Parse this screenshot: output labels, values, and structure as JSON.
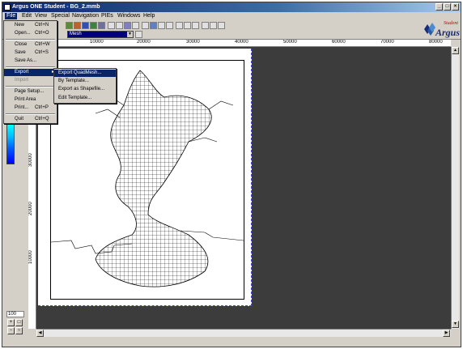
{
  "window": {
    "title": "Argus ONE Student - BG_2.mmb"
  },
  "menubar": {
    "items": [
      "File",
      "Edit",
      "View",
      "Special",
      "Navigation",
      "PIEs",
      "Windows",
      "Help"
    ]
  },
  "toolbar": {
    "layer_combo_value": "Mesh",
    "combo_arrow": "▼"
  },
  "logo": {
    "line1": "Student",
    "line2": "Argus"
  },
  "ruler": {
    "top_labels": [
      "10000",
      "20000",
      "30000",
      "40000",
      "50000",
      "60000",
      "70000",
      "80000"
    ],
    "left_labels": [
      "10000",
      "20000",
      "30000"
    ]
  },
  "file_menu": {
    "items": [
      {
        "label": "New",
        "shortcut": "Ctrl+N"
      },
      {
        "label": "Open...",
        "shortcut": "Ctrl+O"
      },
      {
        "label": "Close",
        "shortcut": "Ctrl+W"
      },
      {
        "label": "Save",
        "shortcut": "Ctrl+S"
      },
      {
        "label": "Save As...",
        "shortcut": ""
      },
      {
        "label": "Export",
        "shortcut": ""
      },
      {
        "label": "Import",
        "shortcut": ""
      },
      {
        "label": "Page Setup...",
        "shortcut": ""
      },
      {
        "label": "Print Area",
        "shortcut": ""
      },
      {
        "label": "Print...",
        "shortcut": "Ctrl+P"
      },
      {
        "label": "Quit",
        "shortcut": "Ctrl+Q"
      }
    ]
  },
  "export_submenu": {
    "items": [
      {
        "label": "Export QuadMesh..."
      },
      {
        "label": "By Template..."
      },
      {
        "label": "Export as Shapefile..."
      },
      {
        "label": "Edit Template..."
      }
    ]
  },
  "left_panel": {
    "zoom_value": "100"
  },
  "colors": {
    "titlebar": "#0a246a",
    "menu_highlight": "#0a246a",
    "canvas": "#3c3c3c",
    "logo_red": "#c00000",
    "logo_blue": "#1a2a7a"
  }
}
